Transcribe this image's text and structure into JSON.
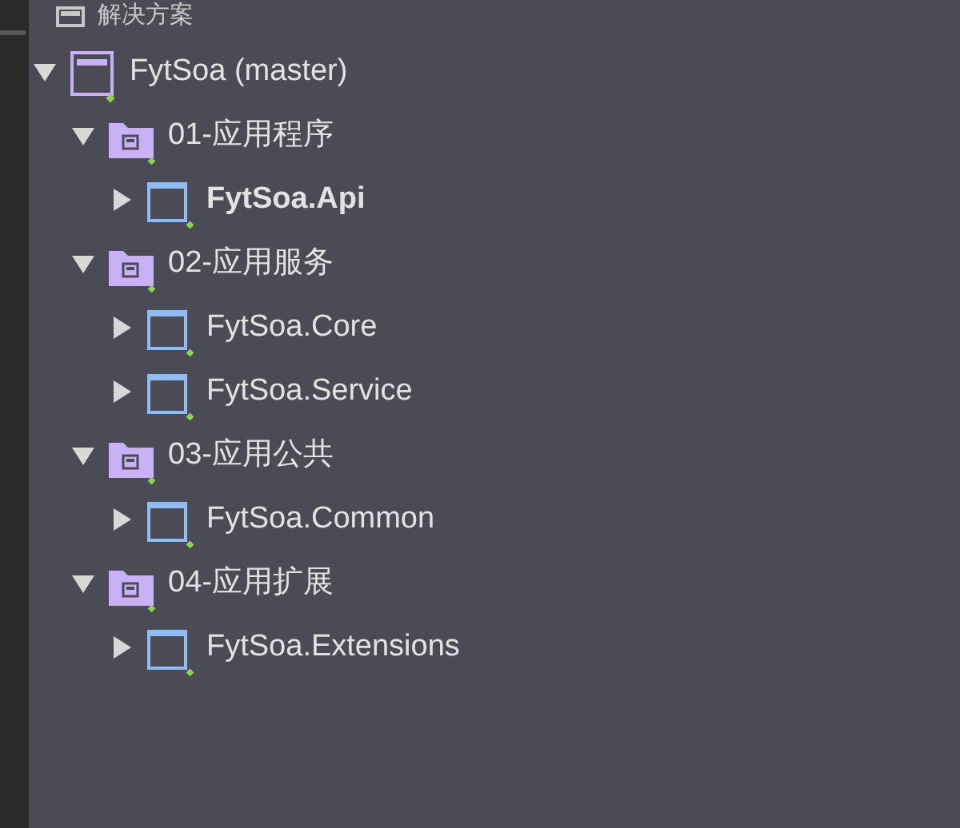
{
  "header": {
    "title": "解决方案"
  },
  "tree": [
    {
      "kind": "solution",
      "label": "FytSoa (master)",
      "expanded": true,
      "children": [
        {
          "kind": "folder",
          "label": "01-应用程序",
          "expanded": true,
          "children": [
            {
              "kind": "project",
              "label": "FytSoa.Api",
              "expanded": false,
              "startup": true
            }
          ]
        },
        {
          "kind": "folder",
          "label": "02-应用服务",
          "expanded": true,
          "children": [
            {
              "kind": "project",
              "label": "FytSoa.Core",
              "expanded": false,
              "startup": false
            },
            {
              "kind": "project",
              "label": "FytSoa.Service",
              "expanded": false,
              "startup": false
            }
          ]
        },
        {
          "kind": "folder",
          "label": "03-应用公共",
          "expanded": true,
          "children": [
            {
              "kind": "project",
              "label": "FytSoa.Common",
              "expanded": false,
              "startup": false
            }
          ]
        },
        {
          "kind": "folder",
          "label": "04-应用扩展",
          "expanded": true,
          "children": [
            {
              "kind": "project",
              "label": "FytSoa.Extensions",
              "expanded": false,
              "startup": false
            }
          ]
        }
      ]
    }
  ]
}
